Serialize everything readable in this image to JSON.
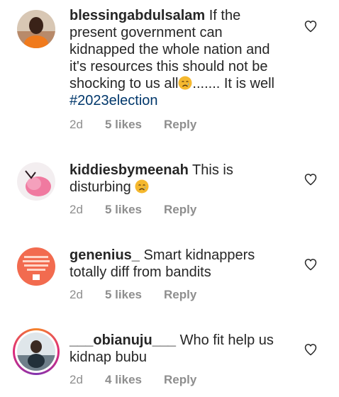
{
  "comments": [
    {
      "username": "blessingabdulsalam",
      "text_before_emoji": "If the present government can kidnapped the whole nation and it's resources this should not be shocking to us all",
      "text_after_emoji": "....... It is well ",
      "hashtag": "#2023election",
      "time": "2d",
      "likes": "5 likes",
      "reply": "Reply",
      "emoji": "crying-face"
    },
    {
      "username": "kiddiesbymeenah",
      "text_before_emoji": "This is disturbing ",
      "time": "2d",
      "likes": "5 likes",
      "reply": "Reply",
      "emoji": "crying-face"
    },
    {
      "username": "genenius_",
      "text": "Smart kidnappers totally diff from bandits",
      "time": "2d",
      "likes": "5 likes",
      "reply": "Reply"
    },
    {
      "username": "___obianuju___",
      "text": "Who fit help us kidnap bubu",
      "time": "2d",
      "likes": "4 likes",
      "reply": "Reply"
    }
  ],
  "colors": {
    "text": "#262626",
    "secondary": "#8e8e8e",
    "hashtag": "#00376b",
    "emoji": "#f5b82e"
  }
}
